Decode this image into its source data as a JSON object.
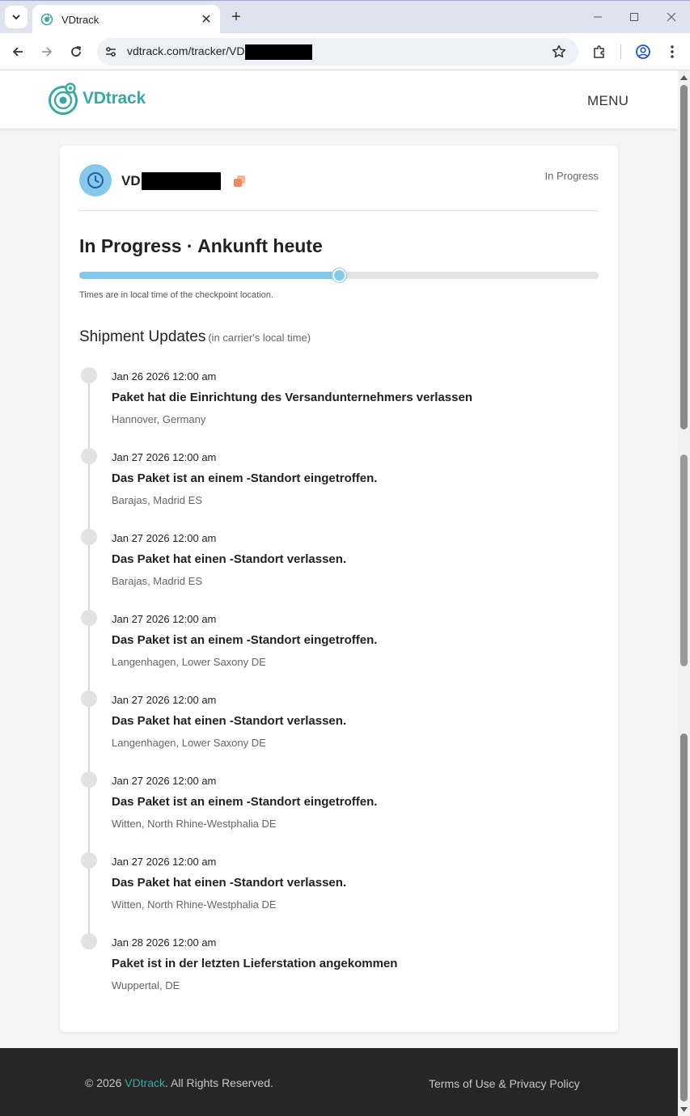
{
  "browser": {
    "tab_title": "VDtrack",
    "url_visible": "vdtrack.com/tracker/VD",
    "new_tab_symbol": "+",
    "close_symbol": "✕"
  },
  "header": {
    "logo_vd": "VD",
    "logo_track": "track",
    "menu_label": "MENU"
  },
  "shipment": {
    "tracking_prefix": "VD",
    "status_badge": "In Progress",
    "status_title": "In Progress · Ankunft heute",
    "progress": 0.5,
    "time_note": "Times are in local time of the checkpoint location.",
    "updates_title": "Shipment Updates",
    "updates_subtitle": "(in carrier's local time)",
    "events": [
      {
        "date": "Jan 26 2026 12:00 am",
        "title": "Paket hat die Einrichtung des Versandunternehmers verlassen",
        "location": "Hannover, Germany"
      },
      {
        "date": "Jan 27 2026 12:00 am",
        "title": "Das Paket ist an einem -Standort eingetroffen.",
        "location": "Barajas, Madrid ES"
      },
      {
        "date": "Jan 27 2026 12:00 am",
        "title": "Das Paket hat einen -Standort verlassen.",
        "location": "Barajas, Madrid ES"
      },
      {
        "date": "Jan 27 2026 12:00 am",
        "title": "Das Paket ist an einem -Standort eingetroffen.",
        "location": "Langenhagen, Lower Saxony DE"
      },
      {
        "date": "Jan 27 2026 12:00 am",
        "title": "Das Paket hat einen -Standort verlassen.",
        "location": "Langenhagen, Lower Saxony DE"
      },
      {
        "date": "Jan 27 2026 12:00 am",
        "title": "Das Paket ist an einem -Standort eingetroffen.",
        "location": "Witten, North Rhine-Westphalia DE"
      },
      {
        "date": "Jan 27 2026 12:00 am",
        "title": "Das Paket hat einen -Standort verlassen.",
        "location": "Witten, North Rhine-Westphalia DE"
      },
      {
        "date": "Jan 28 2026 12:00 am",
        "title": "Paket ist in der letzten Lieferstation angekommen",
        "location": "Wuppertal, DE"
      }
    ]
  },
  "footer": {
    "copyright_prefix": "© 2026 ",
    "brand": "VDtrack",
    "copyright_suffix": ". All Rights Reserved.",
    "legal": "Terms of Use & Privacy Policy"
  },
  "colors": {
    "accent": "#3aa9a4",
    "progress": "#86c8ea",
    "copy_icon": "#f08a5d"
  }
}
